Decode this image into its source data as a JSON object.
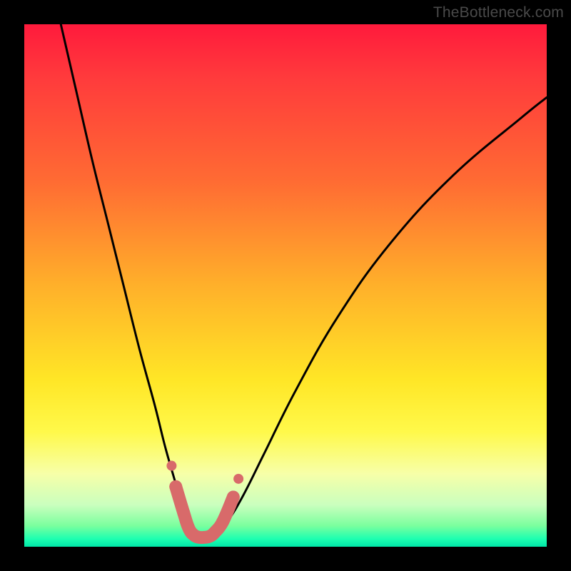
{
  "watermark": "TheBottleneck.com",
  "colors": {
    "page_bg": "#000000",
    "gradient_top": "#ff1a3c",
    "gradient_mid1": "#ff6b33",
    "gradient_mid2": "#ffe626",
    "gradient_bottom": "#00e6a8",
    "curve_stroke": "#000000",
    "marker_stroke": "#d86a6a",
    "marker_fill": "#d86a6a"
  },
  "chart_data": {
    "type": "line",
    "title": "",
    "xlabel": "",
    "ylabel": "",
    "xlim": [
      0,
      100
    ],
    "ylim": [
      0,
      100
    ],
    "grid": false,
    "legend": false,
    "series": [
      {
        "name": "bottleneck-curve",
        "x": [
          7,
          10,
          13,
          16,
          19,
          22,
          25,
          27,
          29,
          30,
          31,
          32,
          33,
          34,
          35.5,
          37,
          39,
          42,
          46,
          52,
          60,
          70,
          82,
          95,
          100
        ],
        "y": [
          100,
          87,
          74,
          62,
          50,
          38,
          27,
          19,
          12,
          8,
          5,
          3,
          2,
          2,
          2,
          3,
          5,
          10,
          18,
          30,
          44,
          58,
          71,
          82,
          86
        ]
      }
    ],
    "markers": {
      "name": "highlight-segment",
      "x": [
        29.0,
        30.5,
        31.5,
        32.5,
        33.5,
        34.5,
        35.5,
        36.5,
        38.0,
        40.0
      ],
      "y": [
        11.5,
        6.5,
        3.5,
        2.2,
        1.8,
        1.8,
        2.0,
        2.8,
        4.8,
        9.5
      ]
    }
  }
}
